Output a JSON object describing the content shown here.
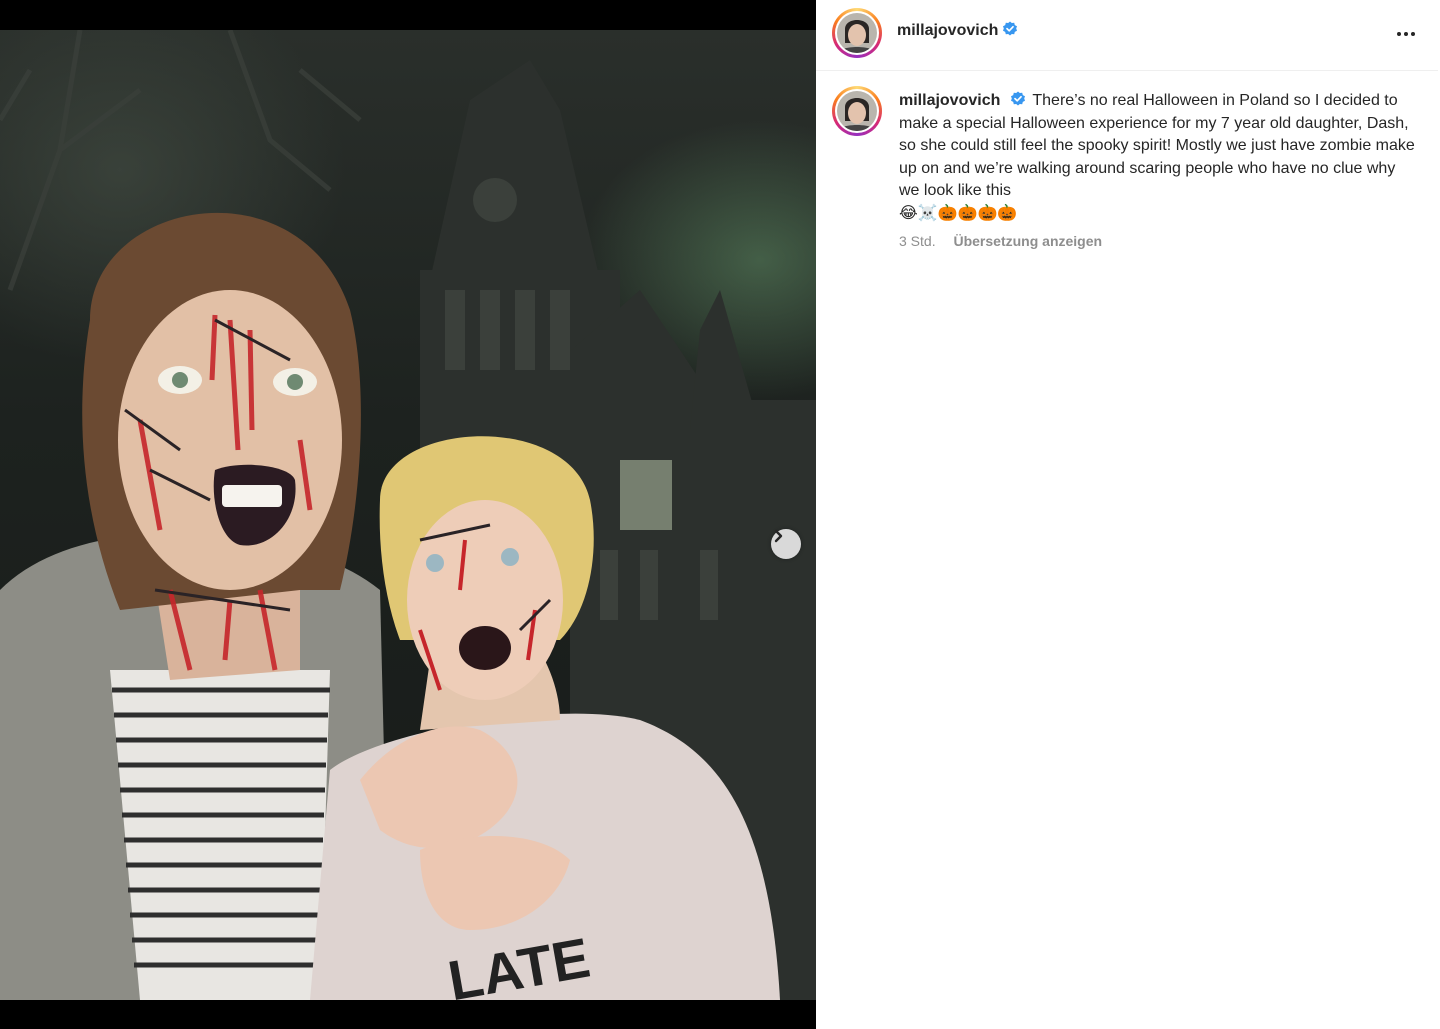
{
  "post": {
    "username": "millajovovich",
    "verified": true,
    "caption_text": "There’s no real Halloween in Poland so I decided to make a special Halloween experience for my 7 year old daughter, Dash, so she could still feel the spooky spirit! Mostly we just have zombie make up on and we’re walking around scaring people who have no clue why we look like this",
    "caption_emojis": "😂☠️🎃🎃🎃🎃",
    "timestamp": "3 Std.",
    "translate_label": "Übersetzung anzeigen"
  },
  "media": {
    "shirt_text": "LATE",
    "carousel_dots_total": 2,
    "carousel_active_index": 0,
    "next_icon": "chevron-right-icon"
  },
  "colors": {
    "verified_blue": "#3897f0",
    "meta_gray": "#8e8e8e",
    "text": "#262626"
  }
}
